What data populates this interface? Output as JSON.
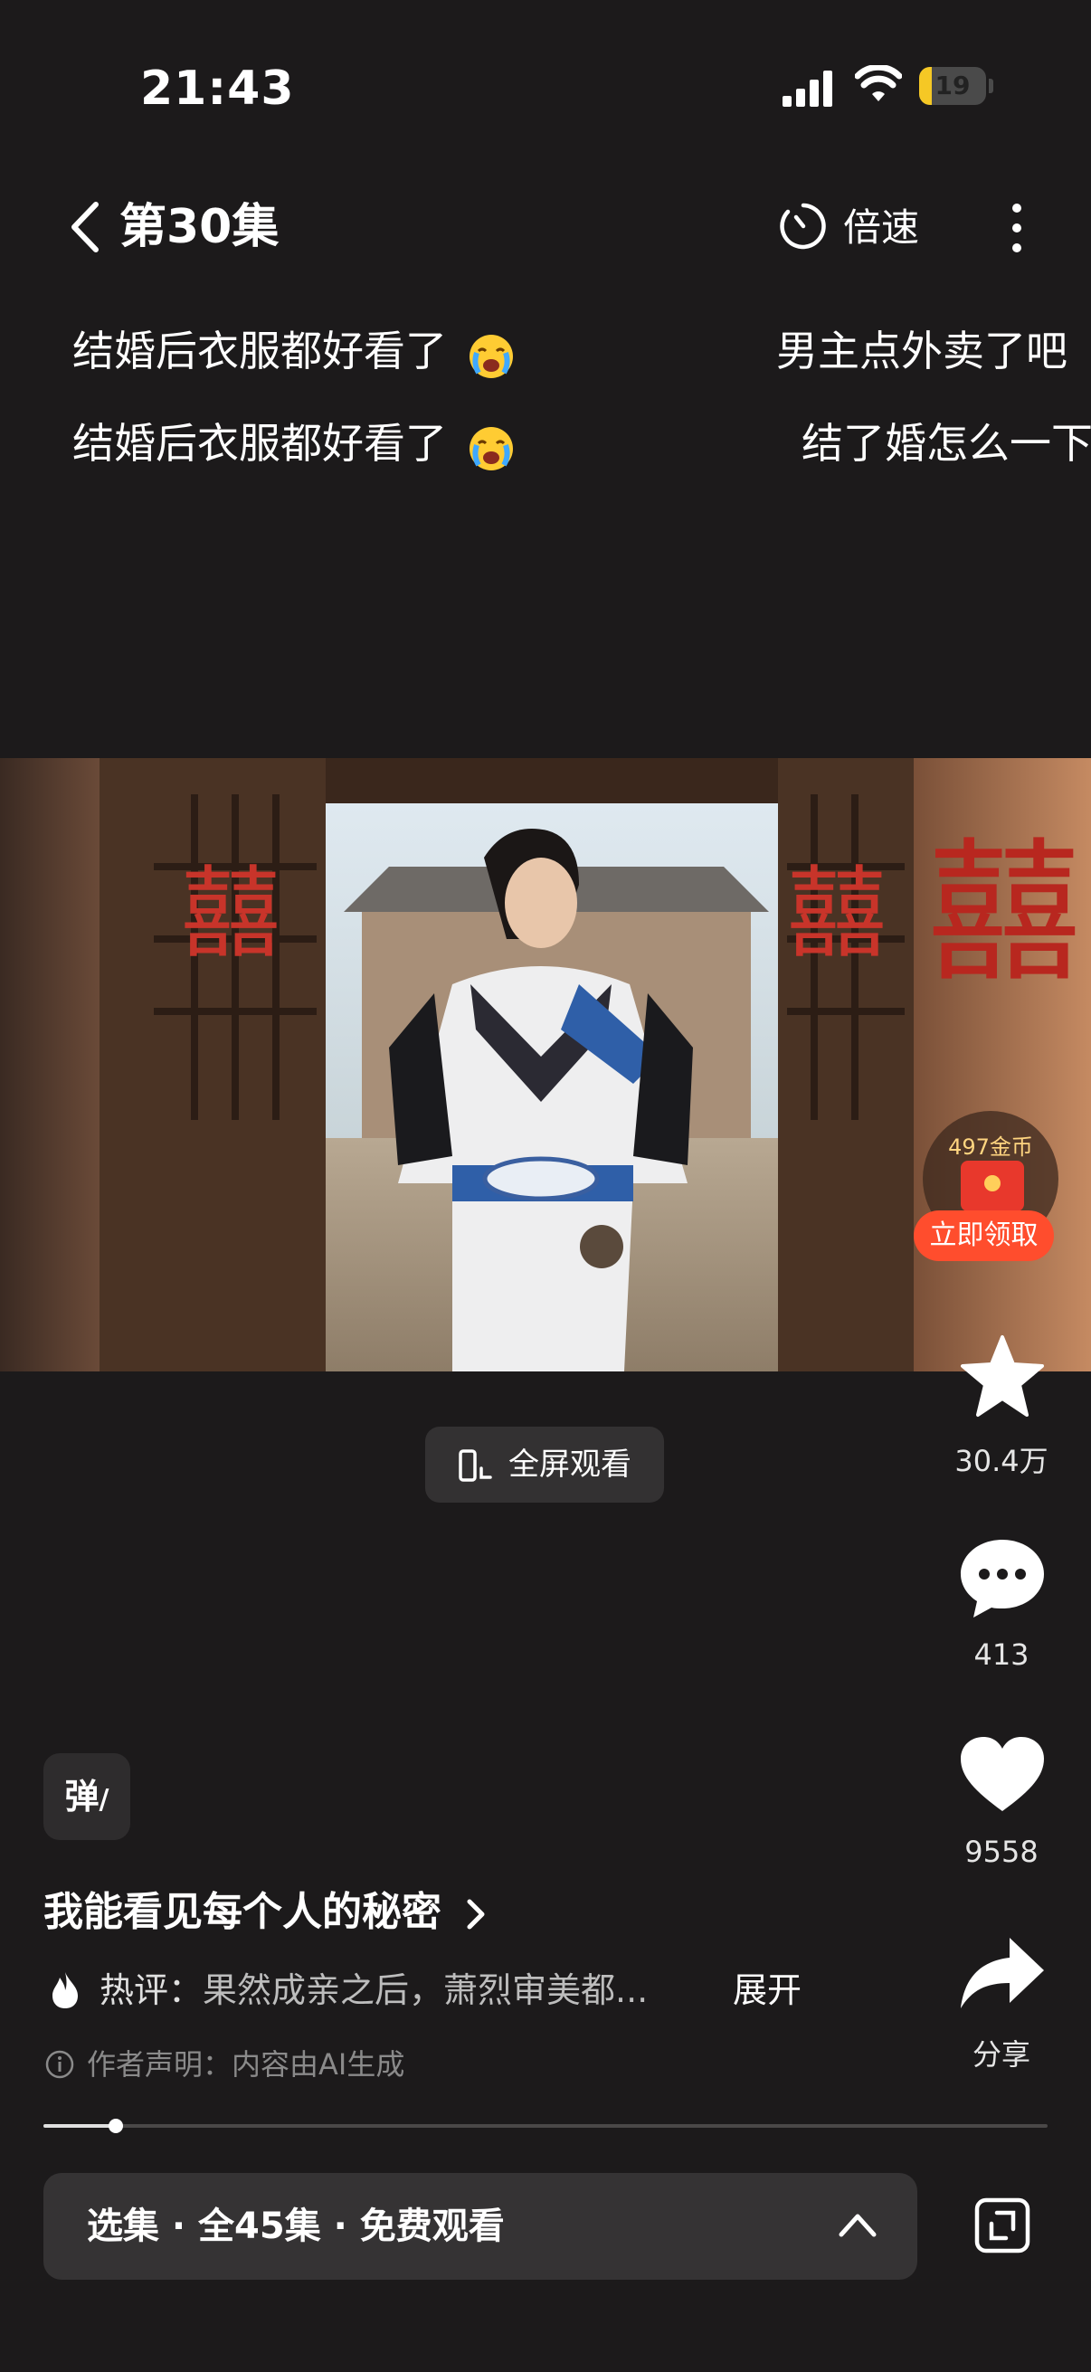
{
  "status_bar": {
    "time": "21:43",
    "battery": "19",
    "battery_level": 0.19
  },
  "header": {
    "back_icon": "chevron-left-icon",
    "title": "第30集",
    "speed_label": "倍速",
    "speed_icon": "timer-icon",
    "more_icon": "more-vertical-icon"
  },
  "danmaku": [
    {
      "text": "结婚后衣服都好看了",
      "emoji": "crying-face-emoji"
    },
    {
      "text": "男主点外卖了吧"
    },
    {
      "text": "结婚后衣服都好看了",
      "emoji": "crying-face-emoji"
    },
    {
      "text": "结了婚怎么一下"
    }
  ],
  "reward": {
    "coins": "497金币",
    "button": "立即领取"
  },
  "fullscreen": {
    "label": "全屏观看"
  },
  "actions": {
    "favorite_count": "30.4万",
    "comment_count": "413",
    "like_count": "9558",
    "share_label": "分享"
  },
  "danmu_toggle": "弹",
  "drama": {
    "title": "我能看见每个人的秘密",
    "hot_prefix": "热评：",
    "hot_comment": "果然成亲之后，萧烈审美都...",
    "expand": "展开",
    "disclaimer": "作者声明：内容由AI生成"
  },
  "playback_progress": 0.072,
  "episodes": {
    "label": "选集 · 全45集 · 免费观看"
  },
  "colors": {
    "background": "#1c1a1b",
    "accent": "#ff4d2d",
    "battery_low": "#f5c825"
  }
}
